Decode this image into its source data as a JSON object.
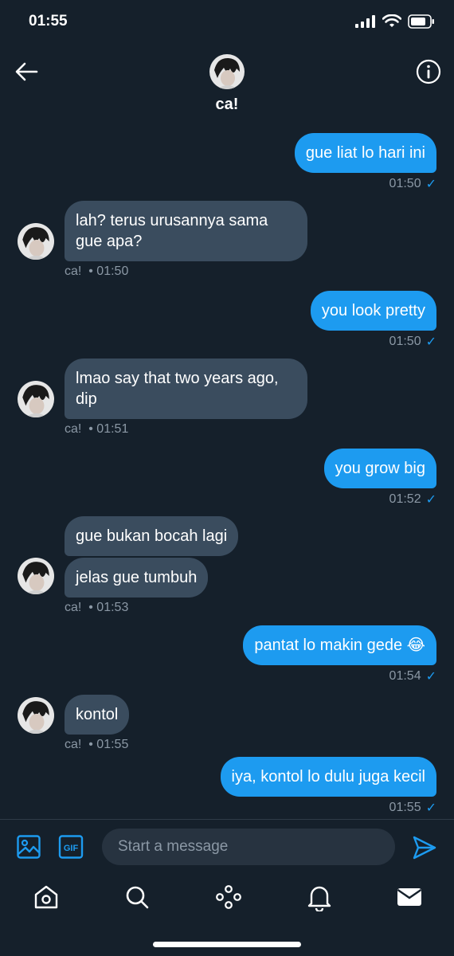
{
  "status": {
    "time": "01:55"
  },
  "header": {
    "name": "ca!"
  },
  "messages": [
    {
      "side": "sent",
      "text": "gue liat lo hari ini",
      "time": "01:50"
    },
    {
      "side": "recv",
      "text": "lah? terus urusannya sama gue apa?",
      "sender": "ca!",
      "time": "01:50"
    },
    {
      "side": "sent",
      "text": "you look pretty",
      "time": "01:50"
    },
    {
      "side": "recv",
      "text": "lmao say that two years ago, dip",
      "sender": "ca!",
      "time": "01:51"
    },
    {
      "side": "sent",
      "text": "you grow big",
      "time": "01:52"
    },
    {
      "side": "recv",
      "text": "gue bukan bocah lagi"
    },
    {
      "side": "recv",
      "text": "jelas gue tumbuh",
      "sender": "ca!",
      "time": "01:53"
    },
    {
      "side": "sent",
      "text": "pantat lo makin gede 😂",
      "time": "01:54"
    },
    {
      "side": "recv",
      "text": "kontol",
      "sender": "ca!",
      "time": "01:55"
    },
    {
      "side": "sent",
      "text": "iya, kontol lo dulu juga kecil",
      "time": "01:55"
    }
  ],
  "composer": {
    "placeholder": "Start a message",
    "gif_label": "GIF"
  },
  "meta_separator": "•",
  "icons": {
    "back": "arrow-left-icon",
    "info": "info-icon",
    "image": "image-icon",
    "gif": "gif-icon",
    "send": "send-icon",
    "tabs": [
      "home-icon",
      "search-icon",
      "spaces-icon",
      "notifications-icon",
      "messages-icon"
    ]
  },
  "colors": {
    "background": "#15202b",
    "accent": "#1d9bf0",
    "received_bubble": "#3a4c5e",
    "muted": "#8b98a5"
  }
}
